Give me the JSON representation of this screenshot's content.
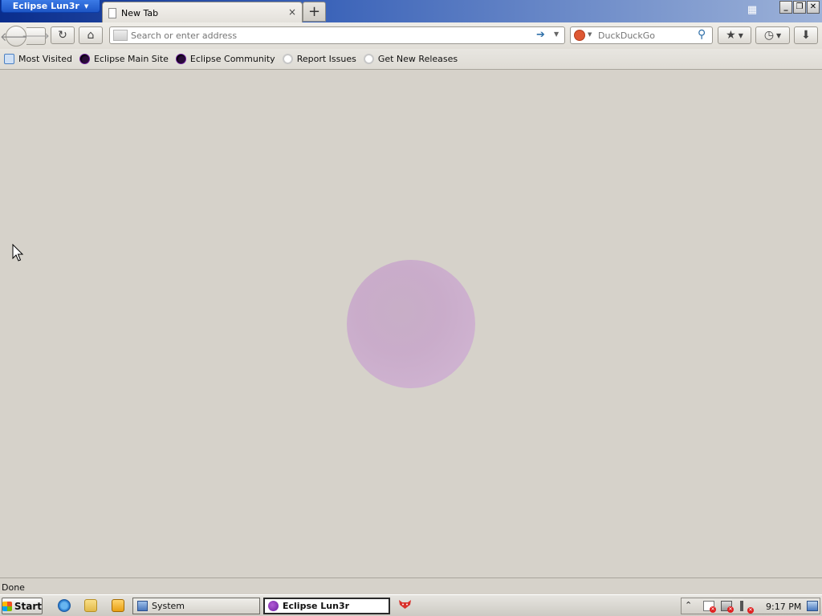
{
  "window": {
    "app_menu_label": "Eclipse Lun3r",
    "tab_title": "New Tab",
    "tab_close_glyph": "×",
    "new_tab_glyph": "+"
  },
  "navbar": {
    "url_placeholder": "Search or enter address",
    "search_placeholder": "DuckDuckGo"
  },
  "bookmarks": [
    {
      "label": "Most Visited",
      "icon": "most-visited-icon"
    },
    {
      "label": "Eclipse Main Site",
      "icon": "eclipse-icon"
    },
    {
      "label": "Eclipse Community",
      "icon": "eclipse-icon"
    },
    {
      "label": "Report Issues",
      "icon": "github-icon"
    },
    {
      "label": "Get New Releases",
      "icon": "github-icon"
    }
  ],
  "status": {
    "text": "Done"
  },
  "taskbar": {
    "start_label": "Start",
    "tasks": [
      {
        "label": "System"
      },
      {
        "label": "Eclipse Lun3r"
      }
    ],
    "clock": "9:17 PM"
  },
  "colors": {
    "content_bg": "#d6d2ca",
    "logo_moon": "#c9a9cb"
  }
}
